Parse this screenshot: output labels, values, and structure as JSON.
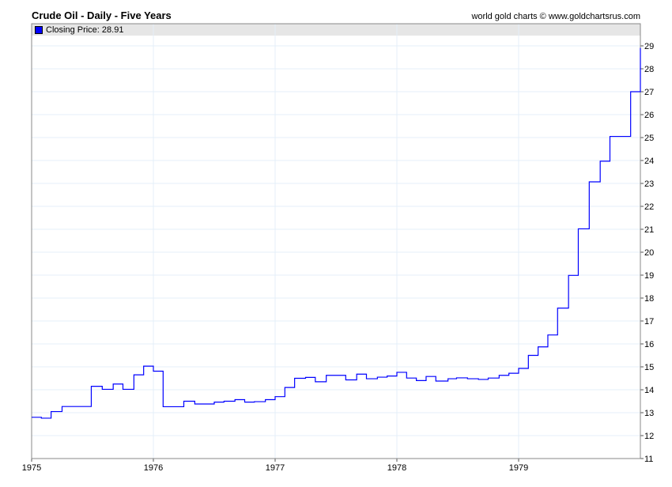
{
  "chart_data": {
    "type": "line",
    "title": "Crude Oil - Daily - Five Years",
    "credit": "world gold charts © www.goldchartsrus.com",
    "legend": {
      "label": "Closing Price: 28.91",
      "color": "#0000ff",
      "placement": "top-left"
    },
    "xlabel": "",
    "ylabel": "",
    "xlim": [
      1975,
      1980
    ],
    "ylim": [
      11,
      29.8
    ],
    "x_ticks": [
      "1975",
      "1976",
      "1977",
      "1978",
      "1979"
    ],
    "y_ticks": [
      11,
      12,
      13,
      14,
      15,
      16,
      17,
      18,
      19,
      20,
      21,
      22,
      23,
      24,
      25,
      26,
      27,
      28,
      29
    ],
    "grid": true,
    "step": true,
    "series": [
      {
        "name": "Closing Price",
        "color": "#0000ff",
        "points": [
          [
            1975.0,
            12.8
          ],
          [
            1975.08,
            12.76
          ],
          [
            1975.16,
            13.05
          ],
          [
            1975.25,
            13.27
          ],
          [
            1975.49,
            14.15
          ],
          [
            1975.58,
            14.02
          ],
          [
            1975.67,
            14.25
          ],
          [
            1975.75,
            14.02
          ],
          [
            1975.84,
            14.65
          ],
          [
            1975.92,
            15.03
          ],
          [
            1976.0,
            14.81
          ],
          [
            1976.08,
            13.26
          ],
          [
            1976.25,
            13.5
          ],
          [
            1976.34,
            13.38
          ],
          [
            1976.5,
            13.46
          ],
          [
            1976.58,
            13.5
          ],
          [
            1976.67,
            13.57
          ],
          [
            1976.75,
            13.46
          ],
          [
            1976.83,
            13.48
          ],
          [
            1976.92,
            13.57
          ],
          [
            1977.0,
            13.7
          ],
          [
            1977.08,
            14.1
          ],
          [
            1977.16,
            14.5
          ],
          [
            1977.25,
            14.54
          ],
          [
            1977.33,
            14.35
          ],
          [
            1977.42,
            14.63
          ],
          [
            1977.58,
            14.43
          ],
          [
            1977.67,
            14.68
          ],
          [
            1977.75,
            14.48
          ],
          [
            1977.84,
            14.55
          ],
          [
            1977.92,
            14.6
          ],
          [
            1978.0,
            14.76
          ],
          [
            1978.08,
            14.51
          ],
          [
            1978.16,
            14.4
          ],
          [
            1978.24,
            14.58
          ],
          [
            1978.32,
            14.38
          ],
          [
            1978.42,
            14.48
          ],
          [
            1978.49,
            14.52
          ],
          [
            1978.58,
            14.48
          ],
          [
            1978.67,
            14.45
          ],
          [
            1978.75,
            14.51
          ],
          [
            1978.84,
            14.63
          ],
          [
            1978.92,
            14.72
          ],
          [
            1979.0,
            14.93
          ],
          [
            1979.08,
            15.5
          ],
          [
            1979.16,
            15.87
          ],
          [
            1979.24,
            16.39
          ],
          [
            1979.32,
            17.56
          ],
          [
            1979.41,
            18.99
          ],
          [
            1979.49,
            21.02
          ],
          [
            1979.58,
            23.07
          ],
          [
            1979.67,
            23.97
          ],
          [
            1979.75,
            25.05
          ],
          [
            1979.92,
            27.0
          ],
          [
            1980.0,
            28.91
          ]
        ]
      }
    ]
  }
}
